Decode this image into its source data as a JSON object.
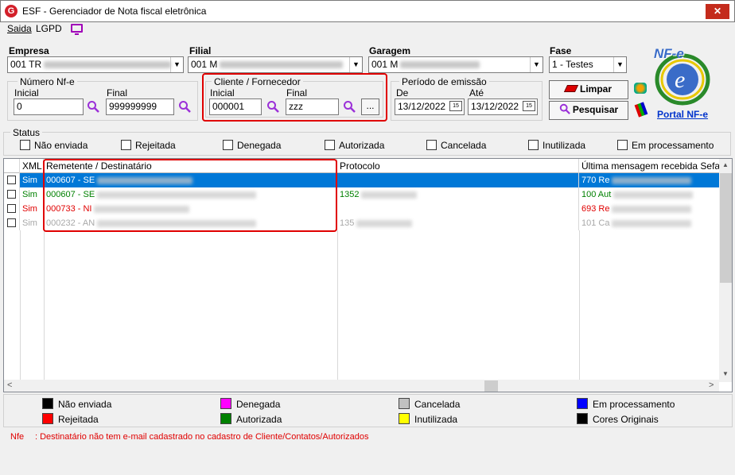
{
  "window": {
    "title": "ESF - Gerenciador de Nota fiscal eletrônica",
    "logo": "G",
    "close": "✕"
  },
  "menu": [
    "Saida",
    "LGPD"
  ],
  "empresa": {
    "label": "Empresa",
    "value": "001 TR"
  },
  "filial": {
    "label": "Filial",
    "value": "001 M"
  },
  "garagem": {
    "label": "Garagem",
    "value": "001 M"
  },
  "fase": {
    "label": "Fase",
    "value": "1 - Testes"
  },
  "numero_nfe": {
    "group": "Número Nf-e",
    "inicial_label": "Inicial",
    "inicial": "0",
    "final_label": "Final",
    "final": "999999999"
  },
  "cliente": {
    "group": "Cliente / Fornecedor",
    "inicial_label": "Inicial",
    "inicial": "000001",
    "final_label": "Final",
    "final": "zzz",
    "more": "..."
  },
  "periodo": {
    "group": "Período de emissão",
    "de_label": "De",
    "de": "13/12/2022",
    "ate_label": "Até",
    "ate": "13/12/2022",
    "cal": "15"
  },
  "buttons": {
    "limpar": "Limpar",
    "pesquisar": "Pesquisar"
  },
  "portal": {
    "logo": "NF-e",
    "link": "Portal NF-e"
  },
  "status": {
    "group": "Status",
    "options": [
      "Não enviada",
      "Rejeitada",
      "Denegada",
      "Autorizada",
      "Cancelada",
      "Inutilizada",
      "Em processamento"
    ]
  },
  "grid": {
    "columns": [
      "XML",
      "Remetente / Destinatário",
      "Protocolo",
      "Última mensagem recebida Sefaz"
    ],
    "rows": [
      {
        "xml": "Sim",
        "remetente": "000607 - SE",
        "protocolo": "",
        "mensagem": "770 Re",
        "color": "#ffffff",
        "selected": true
      },
      {
        "xml": "Sim",
        "remetente": "000607 - SE",
        "protocolo": "1352",
        "mensagem": "100 Aut",
        "color": "#008000",
        "selected": false
      },
      {
        "xml": "Sim",
        "remetente": "000733 - NI",
        "protocolo": "",
        "mensagem": "693 Re",
        "color": "#e00000",
        "selected": false
      },
      {
        "xml": "Sim",
        "remetente": "000232 - AN",
        "protocolo": "135",
        "mensagem": "101 Ca",
        "color": "#a8a8a8",
        "selected": false
      }
    ]
  },
  "legend": [
    {
      "label": "Não enviada",
      "color": "#000000"
    },
    {
      "label": "Denegada",
      "color": "#ff00ff"
    },
    {
      "label": "Cancelada",
      "color": "#c0c0c0"
    },
    {
      "label": "Em processamento",
      "color": "#0000ff"
    },
    {
      "label": "Rejeitada",
      "color": "#ff0000"
    },
    {
      "label": "Autorizada",
      "color": "#008000"
    },
    {
      "label": "Inutilizada",
      "color": "#ffff00"
    },
    {
      "label": "Cores Originais",
      "color": "#000000"
    }
  ],
  "footer": {
    "prefix": "Nfe",
    "message": ": Destinatário não tem e-mail cadastrado no cadastro de Cliente/Contatos/Autorizados"
  },
  "scroll": {
    "left": "<",
    "right": ">",
    "up": "▲",
    "down": "▼"
  },
  "colors": {
    "accent": "#0078d7",
    "highlight_box": "#e00000",
    "link": "#0033cc"
  }
}
